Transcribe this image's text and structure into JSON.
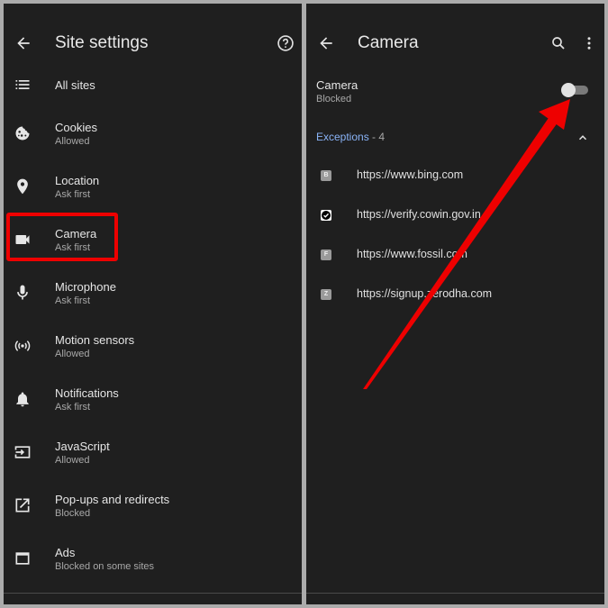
{
  "left_screen": {
    "title": "Site settings",
    "back_icon": "arrow-back-icon",
    "help_icon": "help-circle-icon",
    "items": [
      {
        "icon": "list-icon",
        "label": "All sites",
        "status": ""
      },
      {
        "icon": "cookie-icon",
        "label": "Cookies",
        "status": "Allowed"
      },
      {
        "icon": "location-pin-icon",
        "label": "Location",
        "status": "Ask first"
      },
      {
        "icon": "videocam-icon",
        "label": "Camera",
        "status": "Ask first"
      },
      {
        "icon": "microphone-icon",
        "label": "Microphone",
        "status": "Ask first"
      },
      {
        "icon": "sensors-icon",
        "label": "Motion sensors",
        "status": "Allowed"
      },
      {
        "icon": "bell-icon",
        "label": "Notifications",
        "status": "Ask first"
      },
      {
        "icon": "javascript-icon",
        "label": "JavaScript",
        "status": "Allowed"
      },
      {
        "icon": "open-in-new-icon",
        "label": "Pop-ups and redirects",
        "status": "Blocked"
      },
      {
        "icon": "web-asset-icon",
        "label": "Ads",
        "status": "Blocked on some sites"
      }
    ],
    "highlighted_item": "Camera"
  },
  "right_screen": {
    "title": "Camera",
    "back_icon": "arrow-back-icon",
    "search_icon": "search-icon",
    "more_icon": "more-vert-icon",
    "setting": {
      "label": "Camera",
      "status": "Blocked",
      "enabled": false
    },
    "exceptions": {
      "label": "Exceptions",
      "separator": " - ",
      "count": "4",
      "expanded": true
    },
    "sites": [
      {
        "favicon": "B",
        "url": "https://www.bing.com"
      },
      {
        "favicon": "",
        "url": "https://verify.cowin.gov.in"
      },
      {
        "favicon": "F",
        "url": "https://www.fossil.com"
      },
      {
        "favicon": "Z",
        "url": "https://signup.zerodha.com"
      }
    ]
  },
  "annotation": {
    "color": "#ee0000"
  }
}
